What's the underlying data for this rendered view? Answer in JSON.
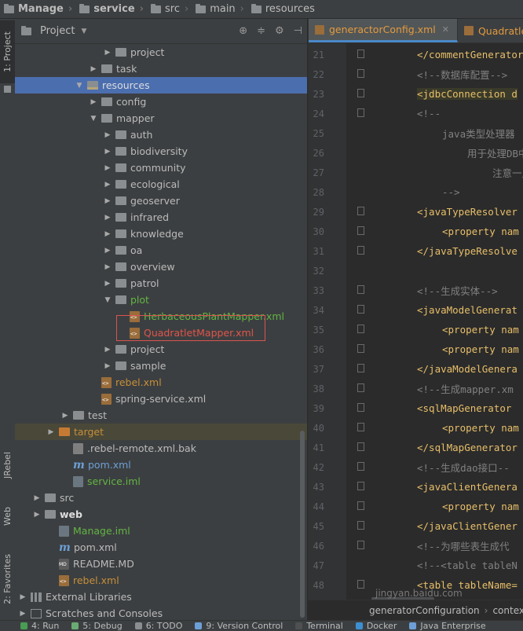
{
  "breadcrumbs": [
    "Manage",
    "service",
    "src",
    "main",
    "resources"
  ],
  "side_tabs": {
    "project": "1: Project",
    "jrebel": "JRebel",
    "web": "Web",
    "favorites": "2: Favorites"
  },
  "project_panel": {
    "title": "Project"
  },
  "tree": [
    {
      "label": "project",
      "kind": "folder",
      "indent": 6,
      "arrow": "right",
      "color": "normal"
    },
    {
      "label": "task",
      "kind": "folder",
      "indent": 5,
      "arrow": "right",
      "color": "normal"
    },
    {
      "label": "resources",
      "kind": "folder-res",
      "indent": 4,
      "arrow": "down",
      "color": "white",
      "selected": true
    },
    {
      "label": "config",
      "kind": "folder",
      "indent": 5,
      "arrow": "right",
      "color": "normal"
    },
    {
      "label": "mapper",
      "kind": "folder",
      "indent": 5,
      "arrow": "down",
      "color": "normal"
    },
    {
      "label": "auth",
      "kind": "folder",
      "indent": 6,
      "arrow": "right",
      "color": "normal"
    },
    {
      "label": "biodiversity",
      "kind": "folder",
      "indent": 6,
      "arrow": "right",
      "color": "normal"
    },
    {
      "label": "community",
      "kind": "folder",
      "indent": 6,
      "arrow": "right",
      "color": "normal"
    },
    {
      "label": "ecological",
      "kind": "folder",
      "indent": 6,
      "arrow": "right",
      "color": "normal"
    },
    {
      "label": "geoserver",
      "kind": "folder",
      "indent": 6,
      "arrow": "right",
      "color": "normal"
    },
    {
      "label": "infrared",
      "kind": "folder",
      "indent": 6,
      "arrow": "right",
      "color": "normal"
    },
    {
      "label": "knowledge",
      "kind": "folder",
      "indent": 6,
      "arrow": "right",
      "color": "normal"
    },
    {
      "label": "oa",
      "kind": "folder",
      "indent": 6,
      "arrow": "right",
      "color": "normal"
    },
    {
      "label": "overview",
      "kind": "folder",
      "indent": 6,
      "arrow": "right",
      "color": "normal"
    },
    {
      "label": "patrol",
      "kind": "folder",
      "indent": 6,
      "arrow": "right",
      "color": "normal"
    },
    {
      "label": "plot",
      "kind": "folder",
      "indent": 6,
      "arrow": "down",
      "color": "green"
    },
    {
      "label": "HerbaceousPlantMapper.xml",
      "kind": "xml",
      "indent": 7,
      "arrow": "none",
      "color": "green"
    },
    {
      "label": "QuadratletMapper.xml",
      "kind": "xml",
      "indent": 7,
      "arrow": "none",
      "color": "red"
    },
    {
      "label": "project",
      "kind": "folder",
      "indent": 6,
      "arrow": "right",
      "color": "normal"
    },
    {
      "label": "sample",
      "kind": "folder",
      "indent": 6,
      "arrow": "right",
      "color": "normal"
    },
    {
      "label": "rebel.xml",
      "kind": "xml",
      "indent": 5,
      "arrow": "none",
      "color": "orange"
    },
    {
      "label": "spring-service.xml",
      "kind": "xml",
      "indent": 5,
      "arrow": "none",
      "color": "normal"
    },
    {
      "label": "test",
      "kind": "folder",
      "indent": 3,
      "arrow": "right",
      "color": "normal"
    },
    {
      "label": "target",
      "kind": "folder-orange",
      "indent": 2,
      "arrow": "right",
      "color": "orange",
      "highlight": true
    },
    {
      "label": ".rebel-remote.xml.bak",
      "kind": "bak",
      "indent": 3,
      "arrow": "none",
      "color": "normal"
    },
    {
      "label": "pom.xml",
      "kind": "maven",
      "indent": 3,
      "arrow": "none",
      "color": "blue"
    },
    {
      "label": "service.iml",
      "kind": "iml",
      "indent": 3,
      "arrow": "none",
      "color": "green"
    },
    {
      "label": "src",
      "kind": "folder",
      "indent": 1,
      "arrow": "right",
      "color": "normal"
    },
    {
      "label": "web",
      "kind": "folder",
      "indent": 1,
      "arrow": "right",
      "color": "white",
      "bold": true
    },
    {
      "label": "Manage.iml",
      "kind": "iml",
      "indent": 2,
      "arrow": "none",
      "color": "green"
    },
    {
      "label": "pom.xml",
      "kind": "maven",
      "indent": 2,
      "arrow": "none",
      "color": "normal"
    },
    {
      "label": "README.MD",
      "kind": "md",
      "indent": 2,
      "arrow": "none",
      "color": "normal"
    },
    {
      "label": "rebel.xml",
      "kind": "xml",
      "indent": 2,
      "arrow": "none",
      "color": "orange"
    },
    {
      "label": "External Libraries",
      "kind": "lib",
      "indent": 0,
      "arrow": "right",
      "color": "normal"
    },
    {
      "label": "Scratches and Consoles",
      "kind": "scratch",
      "indent": 0,
      "arrow": "right",
      "color": "normal"
    }
  ],
  "editor_tabs": [
    {
      "label": "generactorConfig.xml",
      "active": true
    },
    {
      "label": "QuadratletM",
      "active": false
    }
  ],
  "code_lines": [
    {
      "n": "21",
      "text": "</commentGenerator>",
      "col": 2,
      "cls": ""
    },
    {
      "n": "22",
      "text": "<!--数据库配置-->",
      "col": 2,
      "cls": "comment"
    },
    {
      "n": "23",
      "text": "<jdbcConnection d",
      "col": 2,
      "cls": "hl"
    },
    {
      "n": "24",
      "text": "<!--",
      "col": 2,
      "cls": "comment"
    },
    {
      "n": "25",
      "text": "java类型处理器",
      "col": 3,
      "cls": "comment"
    },
    {
      "n": "26",
      "text": "用于处理DB中",
      "col": 4,
      "cls": "comment"
    },
    {
      "n": "27",
      "text": "注意一点,",
      "col": 5,
      "cls": "comment"
    },
    {
      "n": "28",
      "text": "-->",
      "col": 3,
      "cls": "comment"
    },
    {
      "n": "29",
      "text": "<javaTypeResolver",
      "col": 2,
      "cls": ""
    },
    {
      "n": "30",
      "text": "<property nam",
      "col": 3,
      "cls": ""
    },
    {
      "n": "31",
      "text": "</javaTypeResolve",
      "col": 2,
      "cls": ""
    },
    {
      "n": "32",
      "text": "",
      "col": 2,
      "cls": ""
    },
    {
      "n": "33",
      "text": "<!--生成实体-->",
      "col": 2,
      "cls": "comment"
    },
    {
      "n": "34",
      "text": "<javaModelGenerat",
      "col": 2,
      "cls": ""
    },
    {
      "n": "35",
      "text": "<property nam",
      "col": 3,
      "cls": ""
    },
    {
      "n": "36",
      "text": "<property nam",
      "col": 3,
      "cls": ""
    },
    {
      "n": "37",
      "text": "</javaModelGenera",
      "col": 2,
      "cls": ""
    },
    {
      "n": "38",
      "text": "<!--生成mapper.xm",
      "col": 2,
      "cls": "comment"
    },
    {
      "n": "39",
      "text": "<sqlMapGenerator",
      "col": 2,
      "cls": ""
    },
    {
      "n": "40",
      "text": "<property nam",
      "col": 3,
      "cls": ""
    },
    {
      "n": "41",
      "text": "</sqlMapGenerator",
      "col": 2,
      "cls": ""
    },
    {
      "n": "42",
      "text": "<!--生成dao接口--",
      "col": 2,
      "cls": "comment"
    },
    {
      "n": "43",
      "text": "<javaClientGenera",
      "col": 2,
      "cls": ""
    },
    {
      "n": "44",
      "text": "<property nam",
      "col": 3,
      "cls": ""
    },
    {
      "n": "45",
      "text": "</javaClientGener",
      "col": 2,
      "cls": ""
    },
    {
      "n": "46",
      "text": "<!--为哪些表生成代",
      "col": 2,
      "cls": "comment"
    },
    {
      "n": "47",
      "text": "<!--<table tableN",
      "col": 2,
      "cls": "comment"
    },
    {
      "n": "48",
      "text": "<table tableName=",
      "col": 2,
      "cls": ""
    }
  ],
  "editor_breadcrumb": [
    "generatorConfiguration",
    "context"
  ],
  "watermark": "jingyan.baidu.com",
  "status_items": [
    {
      "label": "4: Run",
      "color": "#499c54"
    },
    {
      "label": "5: Debug",
      "color": "#6aab73"
    },
    {
      "label": "6: TODO",
      "color": "#8a8e91"
    },
    {
      "label": "9: Version Control",
      "color": "#6d9fd6"
    },
    {
      "label": "Terminal",
      "color": "#4e5052"
    },
    {
      "label": "Docker",
      "color": "#3d8fd1"
    },
    {
      "label": "Java Enterprise",
      "color": "#6d9fd6"
    }
  ]
}
